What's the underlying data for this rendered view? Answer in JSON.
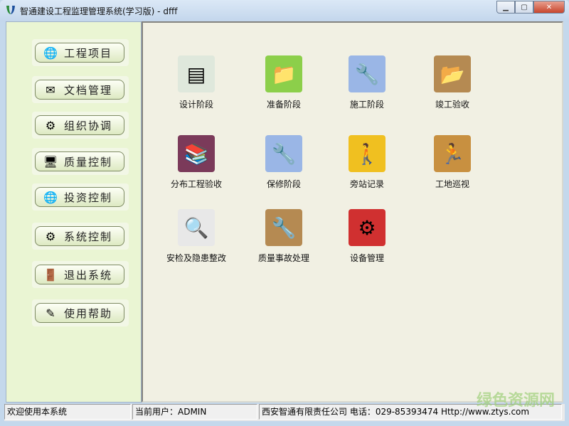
{
  "window": {
    "title": "智通建设工程监理管理系统(学习版) - dfff",
    "min": "▁",
    "max": "▢",
    "close": "✕"
  },
  "sidebar": {
    "items": [
      {
        "label": "工程项目",
        "icon": "globe-icon",
        "glyph": "🌐"
      },
      {
        "label": "文档管理",
        "icon": "envelope-icon",
        "glyph": "✉"
      },
      {
        "label": "组织协调",
        "icon": "org-icon",
        "glyph": "⚙"
      },
      {
        "label": "质量控制",
        "icon": "monitor-icon",
        "glyph": "🖥"
      },
      {
        "label": "投资控制",
        "icon": "globe-cursor-icon",
        "glyph": "🌐"
      },
      {
        "label": "系统控制",
        "icon": "system-icon",
        "glyph": "⚙"
      },
      {
        "label": "退出系统",
        "icon": "exit-door-icon",
        "glyph": "🚪"
      },
      {
        "label": "使用帮助",
        "icon": "help-icon",
        "glyph": "✎"
      }
    ]
  },
  "tiles": [
    {
      "label": "设计阶段",
      "icon": "document-sheet-icon",
      "glyph": "▤",
      "color": "#dfe8dc"
    },
    {
      "label": "准备阶段",
      "icon": "green-folder-icon",
      "glyph": "📁",
      "color": "#8ccf4a"
    },
    {
      "label": "施工阶段",
      "icon": "tools-document-icon",
      "glyph": "🔧",
      "color": "#9ab6e6"
    },
    {
      "label": "竣工验收",
      "icon": "brown-folder-icon",
      "glyph": "📂",
      "color": "#b58a52"
    },
    {
      "label": "分布工程验收",
      "icon": "books-icon",
      "glyph": "📚",
      "color": "#7b3a5a"
    },
    {
      "label": "保修阶段",
      "icon": "tools-document-icon",
      "glyph": "🔧",
      "color": "#9ab6e6"
    },
    {
      "label": "旁站记录",
      "icon": "pedestrian-sign-icon",
      "glyph": "🚶",
      "color": "#f0c020"
    },
    {
      "label": "工地巡视",
      "icon": "runner-folder-icon",
      "glyph": "🏃",
      "color": "#c89040"
    },
    {
      "label": "安检及隐患整改",
      "icon": "magnifier-icon",
      "glyph": "🔍",
      "color": "#e8e8e8"
    },
    {
      "label": "质量事故处理",
      "icon": "wrench-folder-icon",
      "glyph": "🔧",
      "color": "#b58a52"
    },
    {
      "label": "设备管理",
      "icon": "equipment-icon",
      "glyph": "⚙",
      "color": "#d03030"
    }
  ],
  "status": {
    "welcome": "欢迎使用本系统",
    "user": "当前用户：ADMIN",
    "company": "西安智通有限责任公司 电话：029-85393474 Http://www.ztys.com"
  },
  "watermark": "绿色资源网"
}
